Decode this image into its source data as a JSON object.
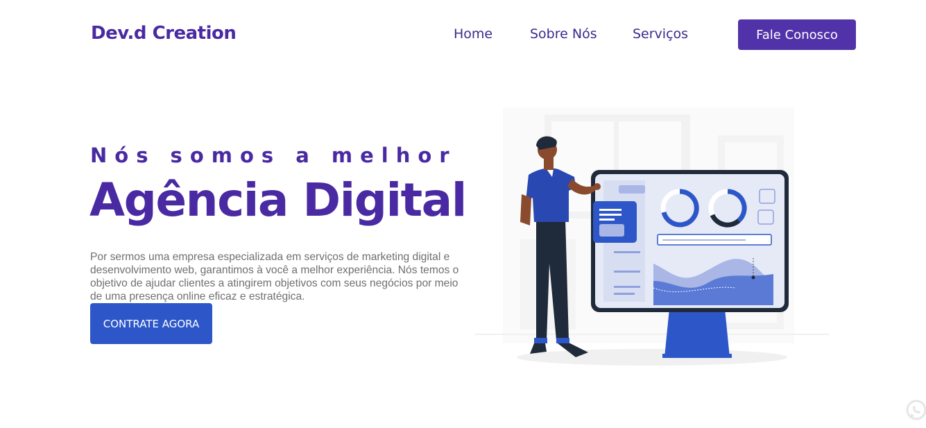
{
  "header": {
    "logo": "Dev.d Creation",
    "nav": [
      "Home",
      "Sobre Nós",
      "Serviços"
    ],
    "cta_label": "Fale Conosco"
  },
  "hero": {
    "kicker": "Nós somos a melhor",
    "headline": "Agência Digital",
    "description": "Por sermos uma empresa especializada em serviços de marketing digital e desenvolvimento web, garantimos à você a melhor experiência. Nós temos o objetivo de ajudar clientes a atingirem objetivos com seus negócios por meio de uma presença online eficaz e estratégica.",
    "button_label": "CONTRATE AGORA"
  },
  "icons": {
    "floating": "whatsapp-icon"
  },
  "colors": {
    "brand_purple": "#4a2aa3",
    "button_purple": "#5232a8",
    "button_blue": "#2d57c9",
    "text_gray": "#6f6f6f"
  }
}
